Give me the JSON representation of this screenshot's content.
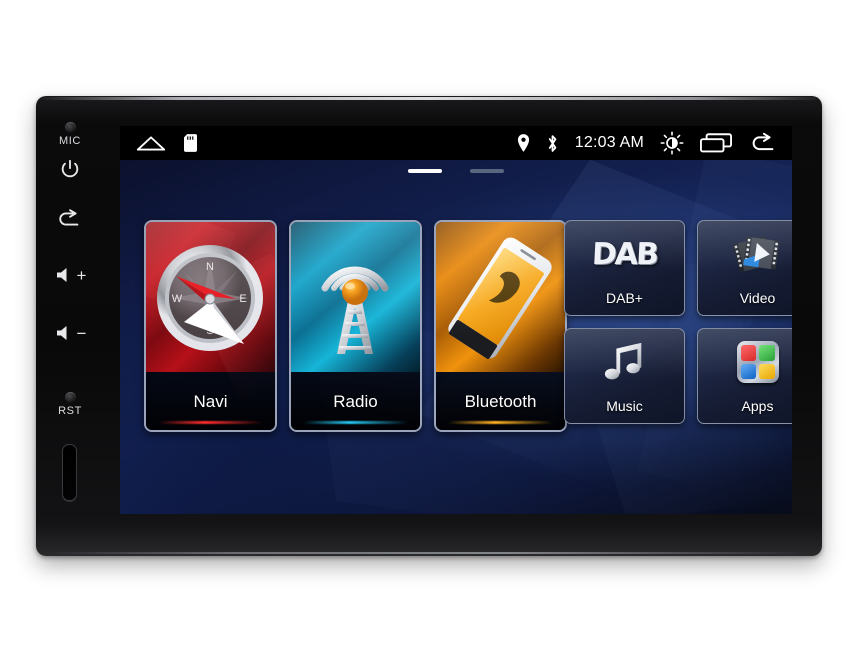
{
  "device": {
    "side_buttons": [
      {
        "name": "mic",
        "label": "MIC",
        "glyph": "hole"
      },
      {
        "name": "power",
        "label": "",
        "glyph": "⏻"
      },
      {
        "name": "back",
        "label": "",
        "glyph": "↰"
      },
      {
        "name": "volume-up",
        "label": "",
        "glyph": "🔊+"
      },
      {
        "name": "volume-down",
        "label": "",
        "glyph": "🔊−"
      },
      {
        "name": "reset",
        "label": "RST",
        "glyph": "hole"
      },
      {
        "name": "card-slot",
        "label": "",
        "glyph": "slot"
      }
    ],
    "volume_up_text": "+",
    "volume_down_text": "−"
  },
  "statusbar": {
    "left_icons": [
      "home-icon",
      "sd-card-icon"
    ],
    "right_icons": [
      "location-pin-icon",
      "bluetooth-icon",
      "brightness-icon",
      "recents-icon",
      "back-icon"
    ],
    "clock": "12:03 AM"
  },
  "home": {
    "page_indicator": {
      "count": 2,
      "active_index": 0
    },
    "primary_tiles": [
      {
        "label": "Navi",
        "icon": "compass-icon",
        "accent": "#ff2d2d"
      },
      {
        "label": "Radio",
        "icon": "radio-tower-icon",
        "accent": "#25c6ef"
      },
      {
        "label": "Bluetooth",
        "icon": "phone-handset-icon",
        "accent": "#ffb222"
      }
    ],
    "secondary_tiles": [
      {
        "label": "DAB+",
        "icon": "dab-logo-icon",
        "wordmark": "DAB"
      },
      {
        "label": "Video",
        "icon": "film-play-icon"
      },
      {
        "label": "Music",
        "icon": "music-note-icon"
      },
      {
        "label": "Apps",
        "icon": "apps-grid-icon"
      }
    ],
    "apps_colors": [
      "#e03131",
      "#2fb344",
      "#1b77d6",
      "#f2b705"
    ]
  }
}
